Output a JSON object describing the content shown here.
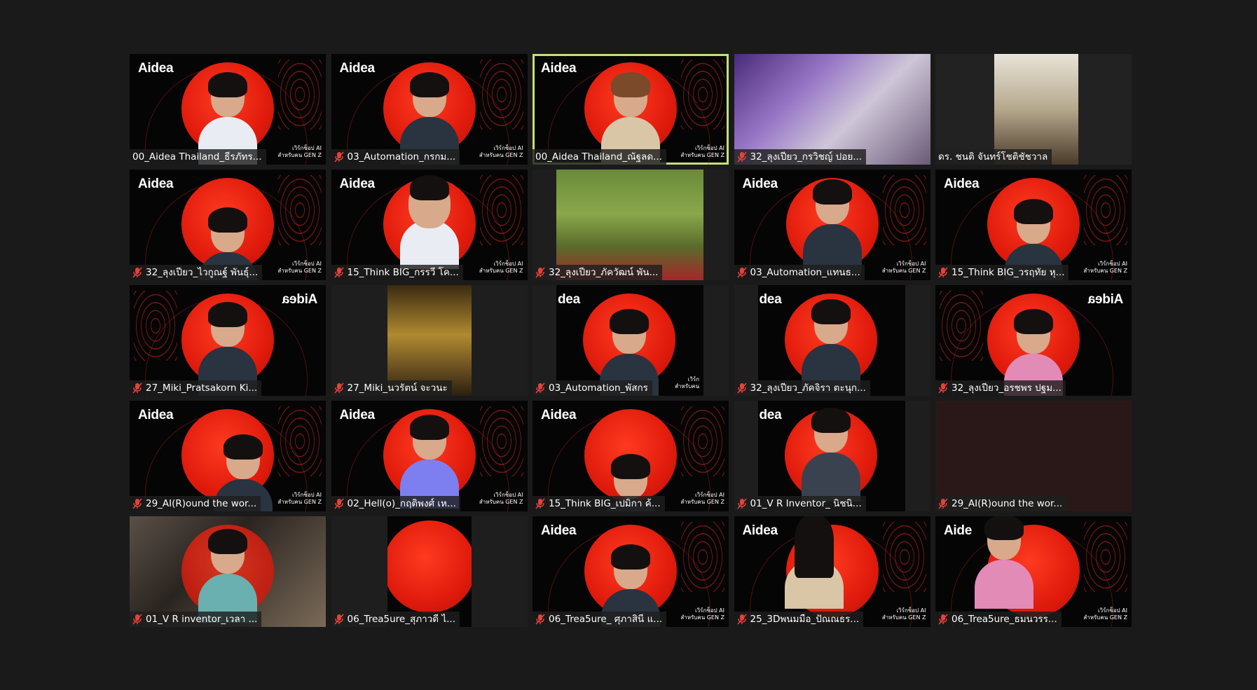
{
  "background_text": {
    "logo": "Aidea",
    "logo_cropped": "dea",
    "logo_cropped2": "Aide",
    "tag_line1": "เวิร์กช็อป AI",
    "tag_line2": "สำหรับคน GEN Z",
    "tag_line1_short": "เวิร์ก",
    "tag_line2_short": "สำหรับคน"
  },
  "participants": [
    {
      "name": "00_Aidea Thailand_ธีรภัทร...",
      "muted": false
    },
    {
      "name": "03_Automation_กรกม...",
      "muted": true
    },
    {
      "name": "00_Aidea Thailand_ณัฐลด...",
      "muted": false,
      "active_speaker": true
    },
    {
      "name": "32_ลุงเปียว_กรวิชญ์ ปอย...",
      "muted": true
    },
    {
      "name": "ดร. ชนติ จันทร์โชติชัชวาล",
      "muted": false
    },
    {
      "name": "32_ลุงเปียว_ไวกูณฐ์ พันธุ์...",
      "muted": true
    },
    {
      "name": "15_Think BIG_กรรวี โค...",
      "muted": true
    },
    {
      "name": "32_ลุงเปียว_ภัควัฒน์ พัน...",
      "muted": true
    },
    {
      "name": "03_Automation_แทนธ...",
      "muted": true
    },
    {
      "name": "15_Think BIG_วรฤทัย หุ...",
      "muted": true
    },
    {
      "name": "27_Miki_Pratsakorn Ki...",
      "muted": true
    },
    {
      "name": "27_Miki_นวรัตน์ จะวนะ",
      "muted": true
    },
    {
      "name": "03_Automation_พัสกร",
      "muted": true
    },
    {
      "name": "32_ลุงเปียว_ภัคจิรา ตะนุก...",
      "muted": true
    },
    {
      "name": "32_ลุงเปียว_อรชพร ปฐม...",
      "muted": true
    },
    {
      "name": "29_AI(R)ound the wor...",
      "muted": true
    },
    {
      "name": "02_Hell(o)_กฤติพงศ์ เห...",
      "muted": true
    },
    {
      "name": "15_Think BIG_เปมิกา ค้...",
      "muted": true
    },
    {
      "name": "01_V R Inventor_ นิชนิ...",
      "muted": true
    },
    {
      "name": "29_AI(R)ound the wor...",
      "muted": true
    },
    {
      "name": "01_V R inventor_เวลา ...",
      "muted": true
    },
    {
      "name": "06_Trea5ure_สุภาวดี ไ...",
      "muted": true
    },
    {
      "name": "06_Trea5ure_ ศุภาสินี แ...",
      "muted": true
    },
    {
      "name": "25_3Dพนมมือ_ปัณณธร...",
      "muted": true
    },
    {
      "name": "06_Trea5ure_ธมนวรร...",
      "muted": true
    }
  ],
  "colors": {
    "app_background": "#1a1a1a",
    "active_speaker_border": "#c3e07a",
    "aidea_red": "#e01b0c",
    "mute_icon": "#e5423a"
  }
}
